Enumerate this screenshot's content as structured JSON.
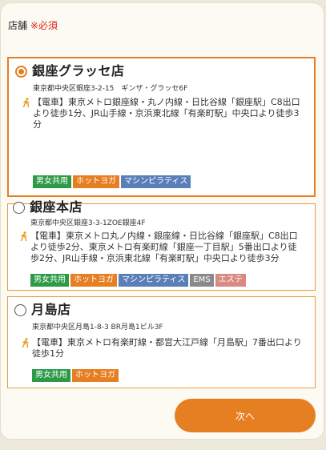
{
  "field": {
    "label": "店舗",
    "required": "※必須"
  },
  "stores": [
    {
      "name": "銀座グラッセ店",
      "selected": true,
      "address": "東京都中央区銀座3-2-15　ギンザ・グラッセ6F",
      "access": "【電車】東京メトロ銀座線・丸ノ内線・日比谷線「銀座駅」C8出口より徒歩1分、JR山手線・京浜東北線「有楽町駅」中央口より徒歩3分",
      "tags": [
        "男女共用",
        "ホットヨガ",
        "マシンピラティス"
      ]
    },
    {
      "name": "銀座本店",
      "selected": false,
      "address": "東京都中央区銀座3-3-1ZOE銀座4F",
      "access": "【電車】東京メトロ丸ノ内線・銀座線・日比谷線「銀座駅」C8出口より徒歩2分、東京メトロ有楽町線「銀座一丁目駅」5番出口より徒歩2分、JR山手線・京浜東北線「有楽町駅」中央口より徒歩3分",
      "tags": [
        "男女共用",
        "ホットヨガ",
        "マシンピラティス",
        "EMS",
        "エステ"
      ]
    },
    {
      "name": "月島店",
      "selected": false,
      "address": "東京都中央区月島1-8-3 BR月島1ビル3F",
      "access": "【電車】東京メトロ有楽町線・都営大江戸線「月島駅」7番出口より徒歩1分",
      "tags": [
        "男女共用",
        "ホットヨガ"
      ]
    }
  ],
  "next_button": "次へ",
  "colors": {
    "accent": "#e67e22",
    "required": "#e2231a",
    "tag_unisex": "#2e9a48",
    "tag_hotyoga": "#e67e22",
    "tag_pilates": "#5a7fb8",
    "tag_ems": "#8a8a8a",
    "tag_esthe": "#d98a82"
  },
  "icons": {
    "access": "walking-person-icon",
    "radio_selected": "radio-checked-icon",
    "radio_unselected": "radio-unchecked-icon"
  }
}
